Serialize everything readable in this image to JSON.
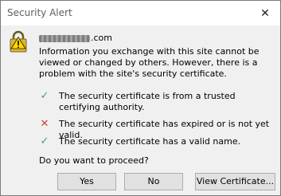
{
  "window": {
    "title": "Security Alert",
    "close_glyph": "✕"
  },
  "site": {
    "domain": ".com"
  },
  "message": "Information you exchange with this site cannot be viewed or changed by others. However, there is a problem with the site's security certificate.",
  "checks": [
    {
      "status": "valid",
      "glyph": "✓",
      "text": "The security certificate is from a trusted certifying authority."
    },
    {
      "status": "invalid",
      "glyph": "✕",
      "text": "The security certificate has expired or is not yet valid."
    },
    {
      "status": "valid",
      "glyph": "✓",
      "text": "The security certificate has a valid name."
    }
  ],
  "question": "Do you want to proceed?",
  "buttons": {
    "yes": "Yes",
    "no": "No",
    "view": "View Certificate..."
  },
  "colors": {
    "check_ok": "#4e9a89",
    "check_bad": "#d0412f",
    "lock_gold": "#e0b43a"
  }
}
